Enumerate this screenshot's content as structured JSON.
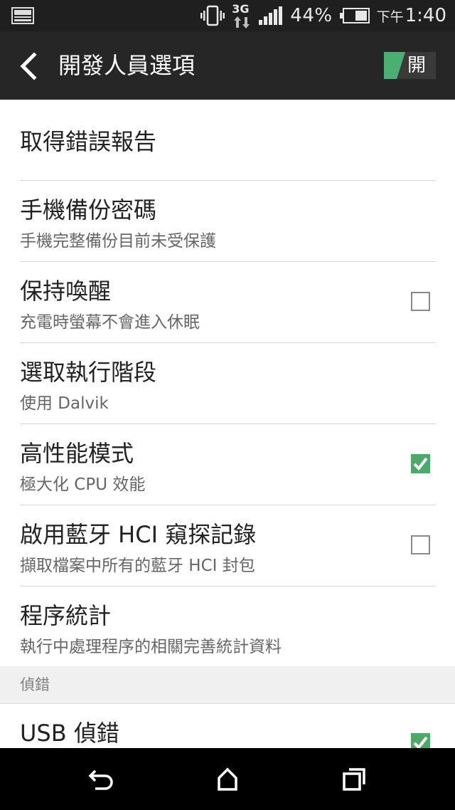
{
  "status_bar": {
    "network_type": "3G",
    "battery_percent": "44%",
    "time_ampm": "下午",
    "time": "1:40",
    "icons": [
      "gallery-notification-icon",
      "vibrate-icon",
      "network-3g-icon",
      "signal-icon",
      "battery-icon"
    ]
  },
  "app_bar": {
    "title": "開發人員選項",
    "master_switch_label": "開",
    "master_switch_on": true
  },
  "settings": [
    {
      "title": "取得錯誤報告",
      "subtitle": "",
      "checkbox": null
    },
    {
      "title": "手機備份密碼",
      "subtitle": "手機完整備份目前未受保護",
      "checkbox": null
    },
    {
      "title": "保持喚醒",
      "subtitle": "充電時螢幕不會進入休眠",
      "checkbox": false
    },
    {
      "title": "選取執行階段",
      "subtitle": "使用 Dalvik",
      "checkbox": null
    },
    {
      "title": "高性能模式",
      "subtitle": "極大化 CPU 效能",
      "checkbox": true
    },
    {
      "title": "啟用藍牙 HCI 窺探記錄",
      "subtitle": "擷取檔案中所有的藍牙 HCI 封包",
      "checkbox": false
    },
    {
      "title": "程序統計",
      "subtitle": "執行中處理程序的相關完善統計資料",
      "checkbox": null
    }
  ],
  "debug_section": {
    "header": "偵錯",
    "items": [
      {
        "title": "USB 偵錯",
        "checkbox": true
      }
    ]
  },
  "colors": {
    "accent_green": "#4da86a",
    "app_bar_bg": "#262626",
    "status_bar_bg": "#1f1f1f"
  }
}
